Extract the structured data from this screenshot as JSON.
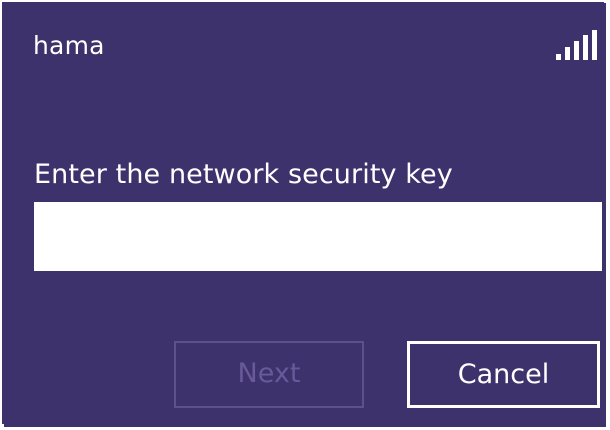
{
  "network": {
    "name": "hama",
    "signal_icon": "signal-strength-icon"
  },
  "prompt": {
    "text": "Enter the network security key"
  },
  "key_input": {
    "value": "",
    "placeholder": ""
  },
  "buttons": {
    "next_label": "Next",
    "cancel_label": "Cancel"
  },
  "colors": {
    "background": "#3e326c",
    "text": "#ffffff",
    "disabled": "#67599a"
  }
}
